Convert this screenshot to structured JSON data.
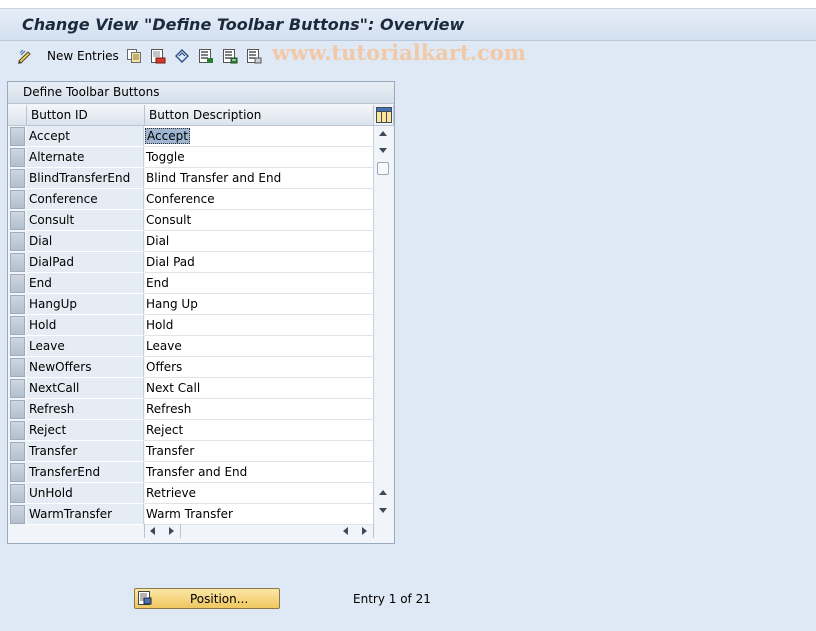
{
  "window": {
    "title": "Change View \"Define Toolbar Buttons\": Overview"
  },
  "toolbar": {
    "new_entries_label": "New Entries",
    "icons": [
      "edit-toggle-icon",
      "copy-icon",
      "delete-icon",
      "undo-icon",
      "select-all-icon",
      "select-block-icon",
      "deselect-all-icon"
    ]
  },
  "watermark": "www.tutorialkart.com",
  "table": {
    "title": "Define Toolbar Buttons",
    "columns": [
      "Button ID",
      "Button Description"
    ],
    "rows": [
      {
        "id": "Accept",
        "desc": "Accept"
      },
      {
        "id": "Alternate",
        "desc": "Toggle"
      },
      {
        "id": "BlindTransferEnd",
        "desc": "Blind Transfer and End"
      },
      {
        "id": "Conference",
        "desc": "Conference"
      },
      {
        "id": "Consult",
        "desc": "Consult"
      },
      {
        "id": "Dial",
        "desc": "Dial"
      },
      {
        "id": "DialPad",
        "desc": "Dial Pad"
      },
      {
        "id": "End",
        "desc": "End"
      },
      {
        "id": "HangUp",
        "desc": "Hang Up"
      },
      {
        "id": "Hold",
        "desc": "Hold"
      },
      {
        "id": "Leave",
        "desc": "Leave"
      },
      {
        "id": "NewOffers",
        "desc": "Offers"
      },
      {
        "id": "NextCall",
        "desc": "Next Call"
      },
      {
        "id": "Refresh",
        "desc": "Refresh"
      },
      {
        "id": "Reject",
        "desc": "Reject"
      },
      {
        "id": "Transfer",
        "desc": "Transfer"
      },
      {
        "id": "TransferEnd",
        "desc": "Transfer and End"
      },
      {
        "id": "UnHold",
        "desc": "Retrieve"
      },
      {
        "id": "WarmTransfer",
        "desc": "Warm Transfer"
      }
    ]
  },
  "footer": {
    "position_label": "Position...",
    "entry_text": "Entry 1 of 21"
  }
}
